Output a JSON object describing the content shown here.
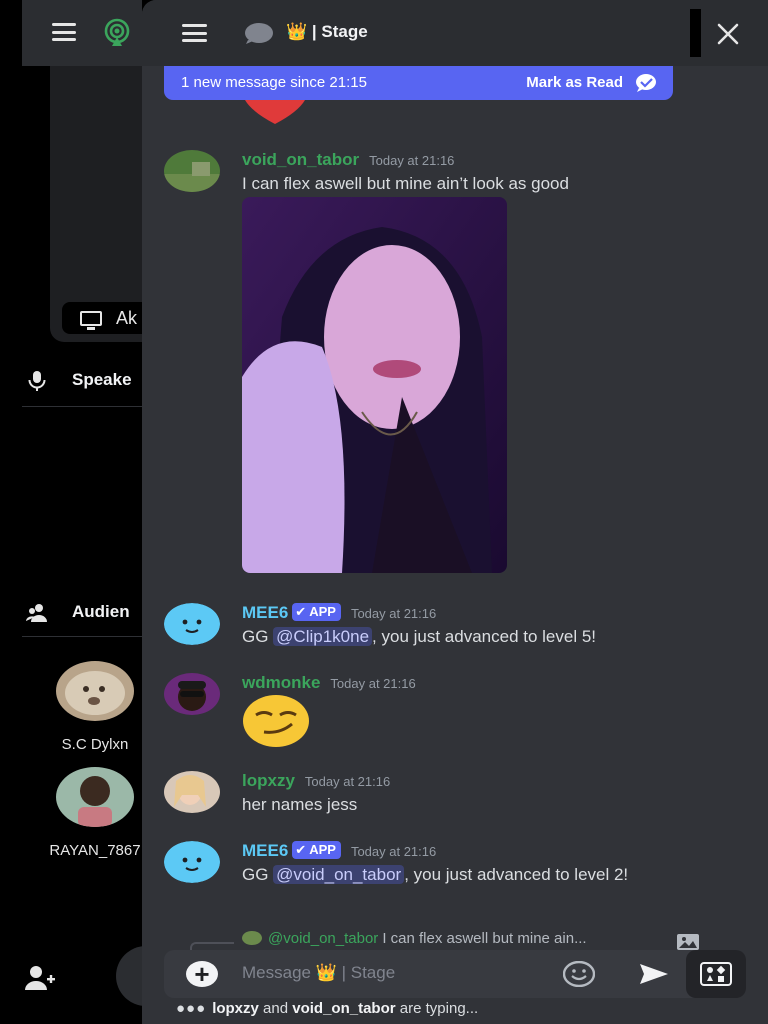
{
  "colors": {
    "accent": "#5865f2",
    "green_user": "#3ba55c",
    "mee6_blue": "#5cc9f5",
    "background": "#313338"
  },
  "left_panel": {
    "menu_icon": "hamburger-icon",
    "stage_icon": "podcast-icon",
    "share_label": "Ak",
    "speakers_label": "Speake",
    "audience_label": "Audien",
    "audience": [
      {
        "name": "S.C Dylxn"
      },
      {
        "name": "RAYAN_7867"
      }
    ]
  },
  "chat": {
    "channel_title": "👑 | Stage",
    "new_banner": {
      "text": "1 new message since 21:15",
      "action": "Mark as Read"
    },
    "messages": [
      {
        "user": "void_on_tabor",
        "time": "Today at 21:16",
        "text": "I can flex aswell but mine ain’t look as good"
      },
      {
        "user": "MEE6",
        "app": "APP",
        "time": "Today at 21:16",
        "pre": "GG ",
        "mention": "@Clip1k0ne",
        "post": ", you just advanced to level 5!"
      },
      {
        "user": "wdmonke",
        "time": "Today at 21:16",
        "emoji": "smirk"
      },
      {
        "user": "lopxzy",
        "time": "Today at 21:16",
        "text": "her names jess"
      },
      {
        "user": "MEE6",
        "app": "APP",
        "time": "Today at 21:16",
        "pre": "GG ",
        "mention": "@void_on_tabor",
        "post": ", you just advanced to level 2!"
      }
    ],
    "reply_preview": {
      "who": "@void_on_tabor",
      "snippet": "I can flex aswell but mine ain..."
    },
    "composer": {
      "placeholder": "Message 👑 | Stage"
    },
    "typing": {
      "user1": "lopxzy",
      "and": "and",
      "user2": "void_on_tabor",
      "suffix": "are typing..."
    }
  }
}
